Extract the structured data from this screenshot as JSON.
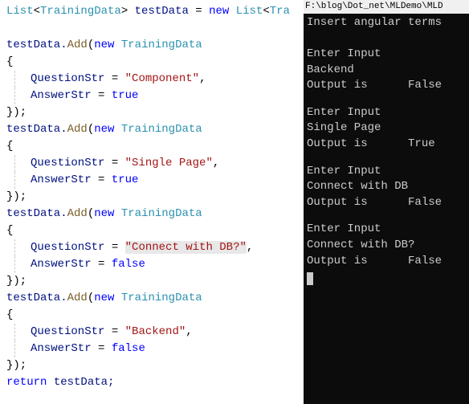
{
  "editor": {
    "declaration": {
      "type1": "List",
      "generic": "TrainingData",
      "varname": "testData",
      "assign": " = ",
      "new": "new",
      "type2": "List",
      "generic2": "Tra"
    },
    "blocks": [
      {
        "callPrefix": "testData.",
        "method": "Add",
        "newKw": "new",
        "ctor": "TrainingData",
        "openBrace": "{",
        "qProp": "QuestionStr",
        "qVal": "\"Component\"",
        "aProp": "AnswerStr",
        "aVal": "true",
        "closeLine": "});"
      },
      {
        "callPrefix": "testData.",
        "method": "Add",
        "newKw": "new",
        "ctor": "TrainingData",
        "openBrace": "{",
        "qProp": "QuestionStr",
        "qVal": "\"Single Page\"",
        "aProp": "AnswerStr",
        "aVal": "true",
        "closeLine": "});"
      },
      {
        "callPrefix": "testData.",
        "method": "Add",
        "newKw": "new",
        "ctor": "TrainingData",
        "openBrace": "{",
        "qProp": "QuestionStr",
        "qVal": "\"Connect with DB?\"",
        "aProp": "AnswerStr",
        "aVal": "false",
        "closeLine": "});",
        "highlight": true
      },
      {
        "callPrefix": "testData.",
        "method": "Add",
        "newKw": "new",
        "ctor": "TrainingData",
        "openBrace": "{",
        "qProp": "QuestionStr",
        "qVal": "\"Backend\"",
        "aProp": "AnswerStr",
        "aVal": "false",
        "closeLine": "});"
      }
    ],
    "returnKw": "return",
    "returnVar": "testData;"
  },
  "terminal": {
    "title": "F:\\blog\\Dot_net\\MLDemo\\MLD",
    "header": "Insert angular terms",
    "groups": [
      {
        "prompt": "Enter Input",
        "input": "Backend",
        "outLabel": "Output is",
        "outValue": "False"
      },
      {
        "prompt": "Enter Input",
        "input": "Single Page",
        "outLabel": "Output is",
        "outValue": "True"
      },
      {
        "prompt": "Enter Input",
        "input": "Connect with DB",
        "outLabel": "Output is",
        "outValue": "False"
      },
      {
        "prompt": "Enter Input",
        "input": "Connect with DB?",
        "outLabel": "Output is",
        "outValue": "False"
      }
    ]
  }
}
